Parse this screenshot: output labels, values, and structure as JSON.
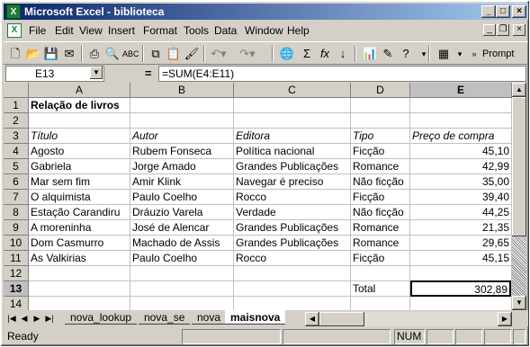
{
  "window": {
    "title": "Microsoft Excel - biblioteca",
    "app_icon": "excel-icon"
  },
  "menu": {
    "items": [
      "File",
      "Edit",
      "View",
      "Insert",
      "Format",
      "Tools",
      "Data",
      "Window",
      "Help"
    ]
  },
  "toolbar": {
    "prompt_label": "Prompt"
  },
  "formula_bar": {
    "name_box": "E13",
    "equals": "=",
    "formula": "=SUM(E4:E11)"
  },
  "sheet": {
    "columns": [
      "A",
      "B",
      "C",
      "D",
      "E"
    ],
    "rows": [
      "1",
      "2",
      "3",
      "4",
      "5",
      "6",
      "7",
      "8",
      "9",
      "10",
      "11",
      "12",
      "13",
      "14"
    ],
    "title": "Relação de livros",
    "headers": [
      "Título",
      "Autor",
      "Editora",
      "Tipo",
      "Preço de compra"
    ],
    "data": [
      [
        "Agosto",
        "Rubem Fonseca",
        "Política nacional",
        "Ficção",
        "45,10"
      ],
      [
        "Gabriela",
        "Jorge Amado",
        "Grandes Publicações",
        "Romance",
        "42,99"
      ],
      [
        "Mar sem fim",
        "Amir Klink",
        "Navegar é preciso",
        "Não ficção",
        "35,00"
      ],
      [
        "O alquimista",
        "Paulo Coelho",
        "Rocco",
        "Ficção",
        "39,40"
      ],
      [
        "Estação Carandiru",
        "Dráuzio Varela",
        "Verdade",
        "Não ficção",
        "44,25"
      ],
      [
        "A moreninha",
        "José de Alencar",
        "Grandes Publicações",
        "Romance",
        "21,35"
      ],
      [
        "Dom Casmurro",
        "Machado de Assis",
        "Grandes Publicações",
        "Romance",
        "29,65"
      ],
      [
        "As Valkirias",
        "Paulo Coelho",
        "Rocco",
        "Ficção",
        "45,15"
      ]
    ],
    "total_label": "Total",
    "total_value": "302,89"
  },
  "tabs": {
    "sheets": [
      "nova_lookup",
      "nova_se",
      "nova",
      "maisnova"
    ],
    "active": "maisnova"
  },
  "status": {
    "text": "Ready",
    "num": "NUM"
  }
}
